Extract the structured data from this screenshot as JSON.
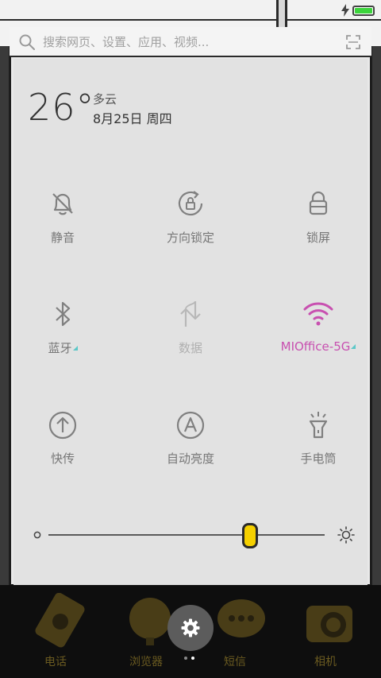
{
  "search": {
    "placeholder": "搜索网页、设置、应用、视频..."
  },
  "weather": {
    "temperature": "26°",
    "condition": "多云",
    "date": "8月25日 周四"
  },
  "tiles": [
    {
      "label": "静音",
      "icon": "bell-off-icon",
      "state": "off"
    },
    {
      "label": "方向锁定",
      "icon": "rotation-lock-icon",
      "state": "off"
    },
    {
      "label": "锁屏",
      "icon": "lock-icon",
      "state": "off"
    },
    {
      "label": "蓝牙",
      "icon": "bluetooth-icon",
      "state": "off",
      "expandable": true
    },
    {
      "label": "数据",
      "icon": "mobile-data-icon",
      "state": "disabled"
    },
    {
      "label": "MIOffice-5G",
      "icon": "wifi-icon",
      "state": "on",
      "expandable": true
    },
    {
      "label": "快传",
      "icon": "transfer-icon",
      "state": "off"
    },
    {
      "label": "自动亮度",
      "icon": "auto-brightness-icon",
      "state": "off"
    },
    {
      "label": "手电筒",
      "icon": "flashlight-icon",
      "state": "off"
    }
  ],
  "brightness": {
    "level": 0.73
  },
  "dock": [
    {
      "label": "电话",
      "icon": "phone-icon"
    },
    {
      "label": "浏览器",
      "icon": "browser-icon"
    },
    {
      "label": "短信",
      "icon": "messages-icon"
    },
    {
      "label": "相机",
      "icon": "camera-icon"
    }
  ],
  "pages": {
    "count": 2,
    "current": 1
  },
  "colors": {
    "accent_active": "#c850b0",
    "battery": "#3cd43c",
    "slider_thumb": "#f5d000",
    "expand_marker": "#5cc8c8"
  }
}
